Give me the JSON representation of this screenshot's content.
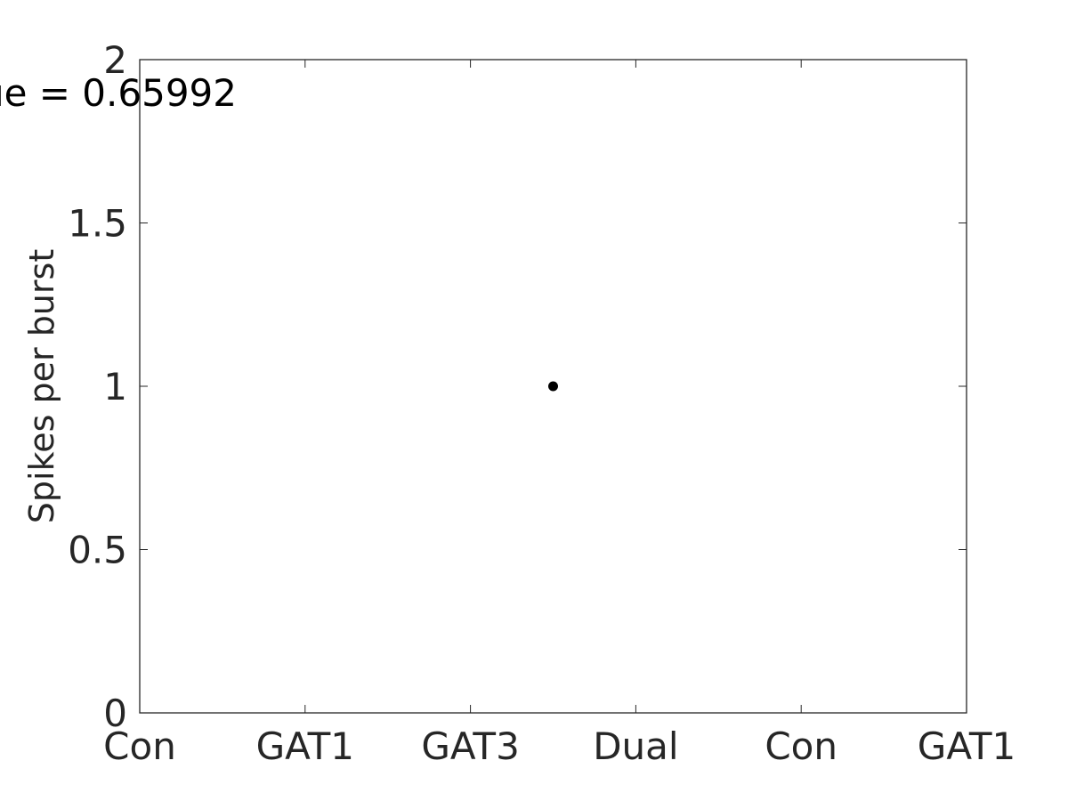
{
  "chart_data": {
    "type": "scatter",
    "title": "ue = 0.65992",
    "xlabel": "",
    "ylabel": "Spikes per burst",
    "xlim": [
      1,
      6
    ],
    "ylim": [
      0,
      2
    ],
    "x_ticks": [
      1,
      2,
      3,
      4,
      5,
      6
    ],
    "x_tick_labels": [
      "Con",
      "GAT1",
      "GAT3",
      "Dual",
      "Con",
      "GAT1"
    ],
    "y_ticks": [
      0,
      0.5,
      1,
      1.5,
      2
    ],
    "y_tick_labels": [
      "0",
      "0.5",
      "1",
      "1.5",
      "2"
    ],
    "grid": false,
    "box": true,
    "series": [
      {
        "name": "data",
        "color": "#000000",
        "points": [
          {
            "x": 3.5,
            "y": 1
          }
        ]
      }
    ]
  }
}
